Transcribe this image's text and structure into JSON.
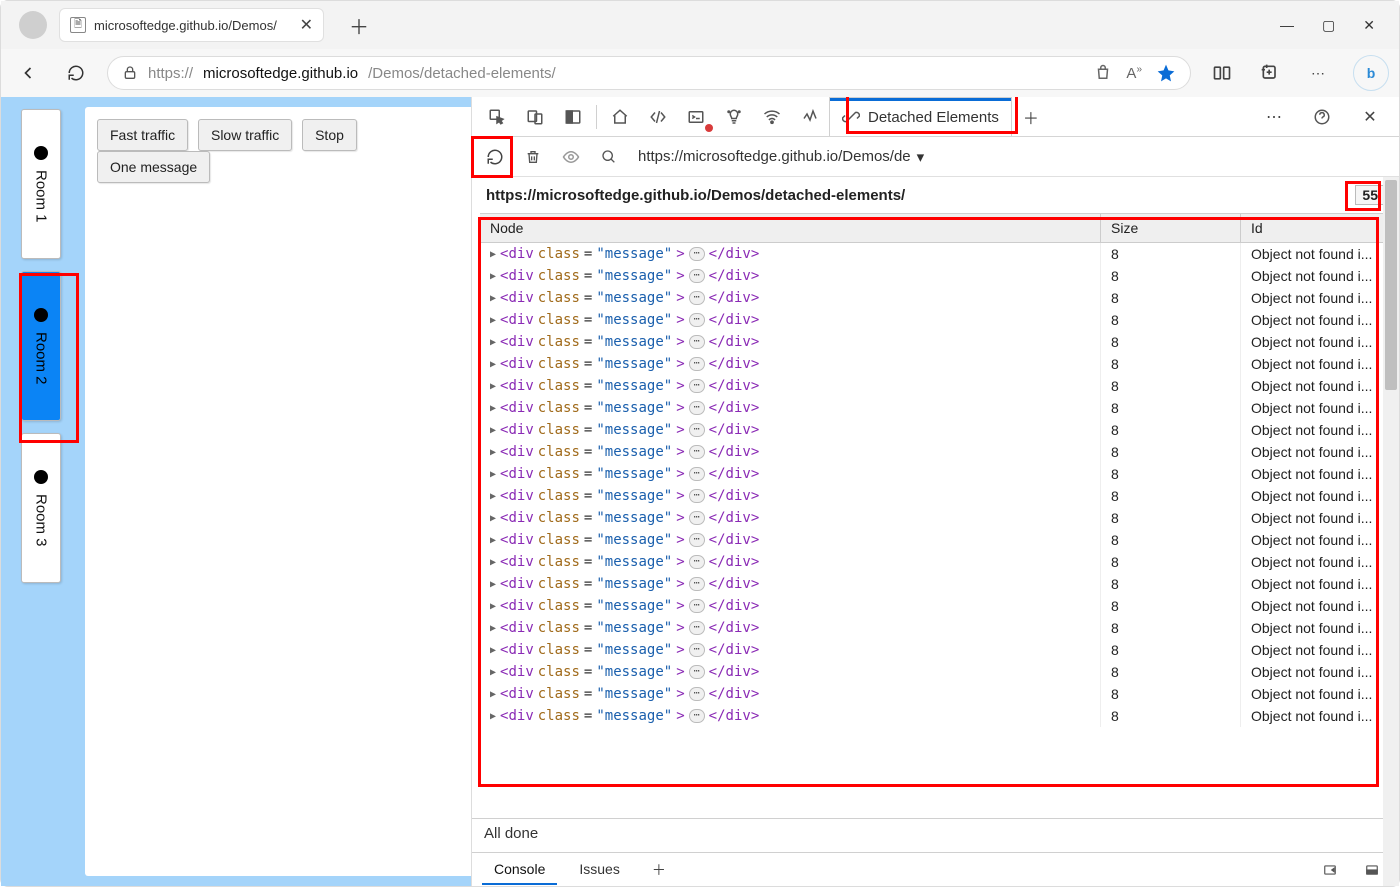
{
  "browser": {
    "tab_title": "microsoftedge.github.io/Demos/",
    "url_prefix": "https://",
    "url_host": "microsoftedge.github.io",
    "url_path": "/Demos/detached-elements/"
  },
  "demo": {
    "rooms": [
      "Room 1",
      "Room 2",
      "Room 3"
    ],
    "active_room_index": 1,
    "buttons": [
      "Fast traffic",
      "Slow traffic",
      "Stop",
      "One message"
    ]
  },
  "devtools": {
    "active_tab": "Detached Elements",
    "toolbar_url": "https://microsoftedge.github.io/Demos/de",
    "section_title": "https://microsoftedge.github.io/Demos/detached-elements/",
    "count": "55",
    "columns": [
      "Node",
      "Size",
      "Id"
    ],
    "row": {
      "node_tag": "div",
      "node_class_attr": "class",
      "node_class_val": "\"message\"",
      "size": "8",
      "id": "Object not found i..."
    },
    "row_count": 22,
    "status": "All done",
    "drawer_tabs": [
      "Console",
      "Issues"
    ]
  }
}
